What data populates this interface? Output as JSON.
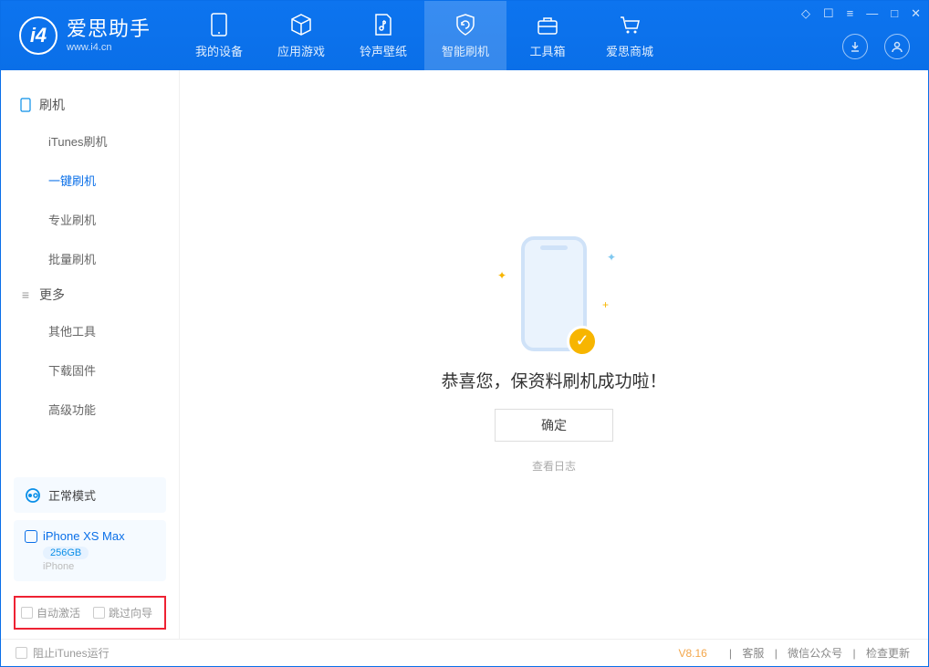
{
  "app": {
    "title": "爱思助手",
    "subtitle": "www.i4.cn",
    "logo_letter": "i4"
  },
  "header_tabs": [
    {
      "label": "我的设备"
    },
    {
      "label": "应用游戏"
    },
    {
      "label": "铃声壁纸"
    },
    {
      "label": "智能刷机"
    },
    {
      "label": "工具箱"
    },
    {
      "label": "爱思商城"
    }
  ],
  "sidebar": {
    "section1": {
      "title": "刷机"
    },
    "items1": [
      {
        "label": "iTunes刷机"
      },
      {
        "label": "一键刷机"
      },
      {
        "label": "专业刷机"
      },
      {
        "label": "批量刷机"
      }
    ],
    "section2": {
      "title": "更多"
    },
    "items2": [
      {
        "label": "其他工具"
      },
      {
        "label": "下载固件"
      },
      {
        "label": "高级功能"
      }
    ],
    "mode": "正常模式",
    "device": {
      "name": "iPhone XS Max",
      "capacity": "256GB",
      "type": "iPhone"
    },
    "cb1": "自动激活",
    "cb2": "跳过向导"
  },
  "main": {
    "message": "恭喜您，保资料刷机成功啦！",
    "ok": "确定",
    "view_log": "查看日志"
  },
  "footer": {
    "block_itunes": "阻止iTunes运行",
    "version": "V8.16",
    "link1": "客服",
    "link2": "微信公众号",
    "link3": "检查更新"
  }
}
